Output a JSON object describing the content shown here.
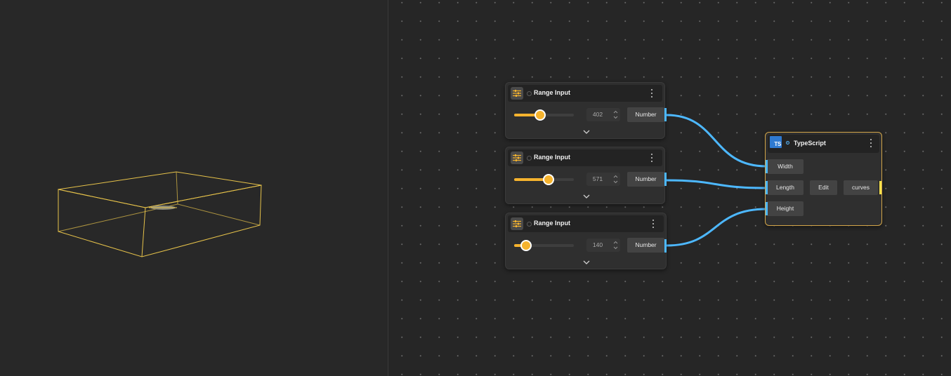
{
  "range_nodes": [
    {
      "title": "Range Input",
      "value": "402",
      "fraction": 0.42,
      "output_label": "Number"
    },
    {
      "title": "Range Input",
      "value": "571",
      "fraction": 0.56,
      "output_label": "Number"
    },
    {
      "title": "Range Input",
      "value": "140",
      "fraction": 0.19,
      "output_label": "Number"
    }
  ],
  "ts_node": {
    "badge": "TS",
    "title": "TypeScript",
    "inputs": [
      "Width",
      "Length",
      "Height"
    ],
    "edit_label": "Edit",
    "output_label": "curves"
  },
  "colors": {
    "accent_orange": "#f5b32e",
    "wire_blue": "#4db8ff",
    "selection_gold": "#d3a64a",
    "ts_blue": "#2f7ad1"
  },
  "icons": {
    "range_node": "sliders-icon",
    "menu": "kebab-menu-icon",
    "expand": "chevron-down-icon"
  }
}
